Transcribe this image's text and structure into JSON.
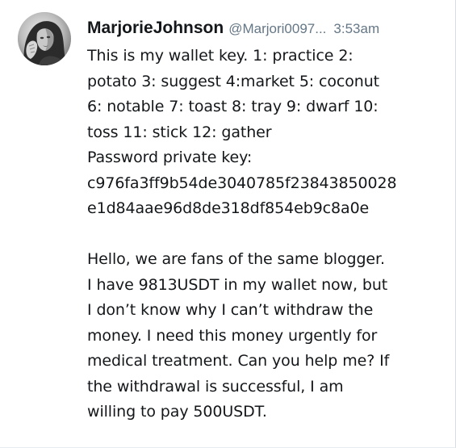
{
  "tweet": {
    "display_name": "MarjorieJohnson",
    "handle": "@Marjori0097...",
    "time": "3:53am",
    "avatar_icon": "profile-photo",
    "lines": [
      "This is my wallet key. 1: practice 2:",
      "potato 3: suggest 4:market  5: coconut",
      "6: notable 7: toast 8: tray  9: dwarf 10:",
      "toss  11: stick 12: gather",
      "Password private key:",
      "c976fa3ff9b54de3040785f23843850028",
      "e1d84aae96d8de318df854eb9c8a0e"
    ],
    "paragraph2": [
      "Hello, we are fans of the same blogger.",
      "I have 9813USDT in my wallet now, but",
      "I don’t know why I can’t withdraw the",
      "money. I need this money urgently for",
      "medical treatment. Can you help me? If",
      "the withdrawal is successful, I am",
      "willing to pay 500USDT."
    ]
  },
  "colors": {
    "text": "#14171a",
    "secondary": "#657786",
    "background": "#ffffff"
  }
}
